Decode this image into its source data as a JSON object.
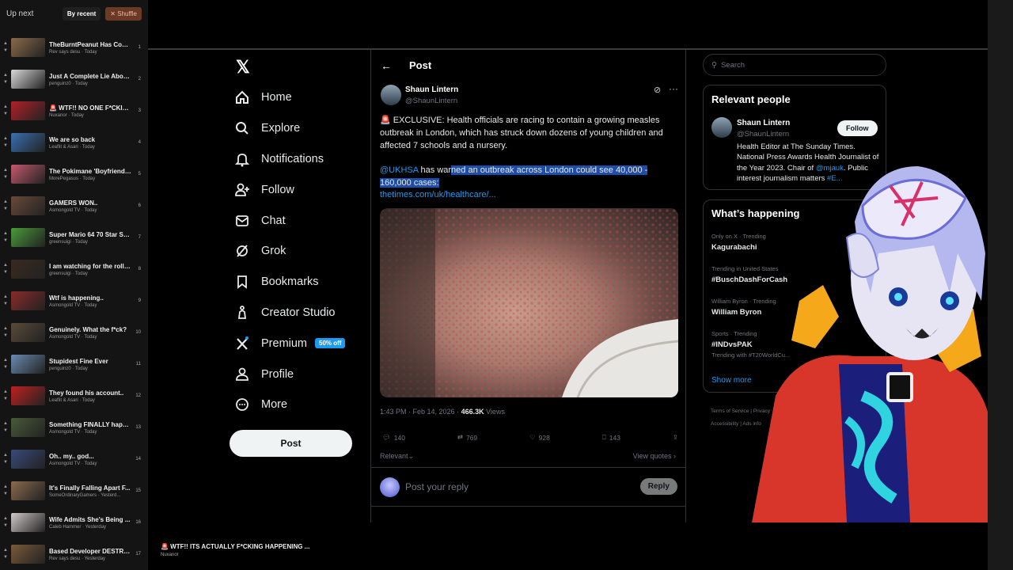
{
  "queue": {
    "title": "Up next",
    "by_recent": "By recent",
    "shuffle": "Shuffle",
    "items": [
      {
        "title": "TheBurntPeanut Has Com...",
        "meta": "Rev says desu · Today",
        "num": "1",
        "thumb": "#8a6a4a"
      },
      {
        "title": "Just A Complete Lie About...",
        "meta": "penguinz0 · Today",
        "num": "2",
        "thumb": "#d8d8d8"
      },
      {
        "title": "🚨 WTF!! NO ONE F*CKIN...",
        "meta": "Nuxanor · Today",
        "num": "3",
        "thumb": "#b3202a"
      },
      {
        "title": "We are so back",
        "meta": "Leaflit & Asari · Today",
        "num": "4",
        "thumb": "#3a6fb0"
      },
      {
        "title": "The Pokimane 'Boyfriend' ...",
        "meta": "MorePegasus · Today",
        "num": "5",
        "thumb": "#c45a6e"
      },
      {
        "title": "GAMERS WON..",
        "meta": "Asmongold TV · Today",
        "num": "6",
        "thumb": "#6a4a3a"
      },
      {
        "title": "Super Mario 64 70 Star Sp...",
        "meta": "greensuigi · Today",
        "num": "7",
        "thumb": "#4a9a3a"
      },
      {
        "title": "I am watching for the rollin...",
        "meta": "greensuigi · Today",
        "num": "8",
        "thumb": "#3a2a20"
      },
      {
        "title": "Wtf is happening..",
        "meta": "Asmongold TV · Today",
        "num": "9",
        "thumb": "#8a2a2a"
      },
      {
        "title": "Genuinely. What the f*ck?",
        "meta": "Asmongold TV · Today",
        "num": "10",
        "thumb": "#5a4a3a"
      },
      {
        "title": "Stupidest Fine Ever",
        "meta": "penguinz0 · Today",
        "num": "11",
        "thumb": "#6a8ab0"
      },
      {
        "title": "They found his account..",
        "meta": "Leaflit & Asari · Today",
        "num": "12",
        "thumb": "#c02020"
      },
      {
        "title": "Something FINALLY happ...",
        "meta": "Asmongold TV · Today",
        "num": "13",
        "thumb": "#4a5a3a"
      },
      {
        "title": "Oh.. my.. god...",
        "meta": "Asmongold TV · Today",
        "num": "14",
        "thumb": "#3a4a7a"
      },
      {
        "title": "It's Finally Falling Apart F...",
        "meta": "SomeOrdinaryGamers · Yesterd...",
        "num": "15",
        "thumb": "#8a6a50"
      },
      {
        "title": "Wife Admits She's Being ...",
        "meta": "Caleb Hammer · Yesterday",
        "num": "16",
        "thumb": "#d0c8c8"
      },
      {
        "title": "Based Developer DESTRO...",
        "meta": "Rev says desu · Yesterday",
        "num": "17",
        "thumb": "#7a5a3a"
      }
    ]
  },
  "now_playing": {
    "title": "🚨 WTF!! ITS ACTUALLY F*CKING HAPPENING ...",
    "channel": "Nuxanor"
  },
  "nav": {
    "logo": "𝕏",
    "items": [
      {
        "label": "Home",
        "icon": "home-icon"
      },
      {
        "label": "Explore",
        "icon": "search-icon"
      },
      {
        "label": "Notifications",
        "icon": "bell-icon"
      },
      {
        "label": "Follow",
        "icon": "add-person-icon"
      },
      {
        "label": "Chat",
        "icon": "mail-icon"
      },
      {
        "label": "Grok",
        "icon": "grok-icon"
      },
      {
        "label": "Bookmarks",
        "icon": "bookmark-icon"
      },
      {
        "label": "Creator Studio",
        "icon": "creator-icon"
      },
      {
        "label": "Premium",
        "icon": "x-premium-icon"
      },
      {
        "label": "Profile",
        "icon": "person-icon"
      },
      {
        "label": "More",
        "icon": "more-circle-icon"
      }
    ],
    "premium_badge": "50% off",
    "post_button": "Post"
  },
  "post": {
    "header_title": "Post",
    "author_name": "Shaun Lintern",
    "author_handle": "@ShaunLintern",
    "text_siren": "🚨",
    "text_main": " EXCLUSIVE: Health officials are racing to contain a growing measles outbreak in London, which has struck down dozens of young children and affected 7 schools and a nursery.",
    "mention": "@UKHSA",
    "text2_a": " has war",
    "text2_hl": "ned an outbreak across London could see 40,000 - 160,000 cases:",
    "link": "thetimes.com/uk/healthcare/...",
    "time": "1:43 PM · Feb 14, 2026 · ",
    "views_count": "466.3K",
    "views_label": " Views",
    "replies": "140",
    "reposts": "769",
    "likes": "928",
    "bookmarks": "143",
    "relevant": "Relevant",
    "view_quotes": "View quotes",
    "reply_placeholder": "Post your reply",
    "reply_button": "Reply"
  },
  "sidebar": {
    "search_placeholder": "Search",
    "relevant_title": "Relevant people",
    "person_name": "Shaun Lintern",
    "person_handle": "@ShaunLintern",
    "follow": "Follow",
    "bio_text": "Health Editor at The Sunday Times. National Press Awards Health Journalist of the Year 2023. Chair of ",
    "bio_mention": "@mjauk",
    "bio_text2": ". Public interest journalism matters ",
    "bio_tag": "#E...",
    "happening_title": "What’s happening",
    "trends": [
      {
        "meta": "Only on X · Trending",
        "name": "Kagurabachi",
        "extra": ""
      },
      {
        "meta": "Trending in United States",
        "name": "#BuschDashForCash",
        "extra": ""
      },
      {
        "meta": "William Byron · Trending",
        "name": "William Byron",
        "extra": ""
      },
      {
        "meta": "Sports · Trending",
        "name": "#INDvsPAK",
        "extra": "Trending with #T20WorldCu..."
      }
    ],
    "show_more": "Show more",
    "footer1": "Terms of Service  |  Privacy",
    "footer2": "Accessibility  |  Ads info"
  }
}
